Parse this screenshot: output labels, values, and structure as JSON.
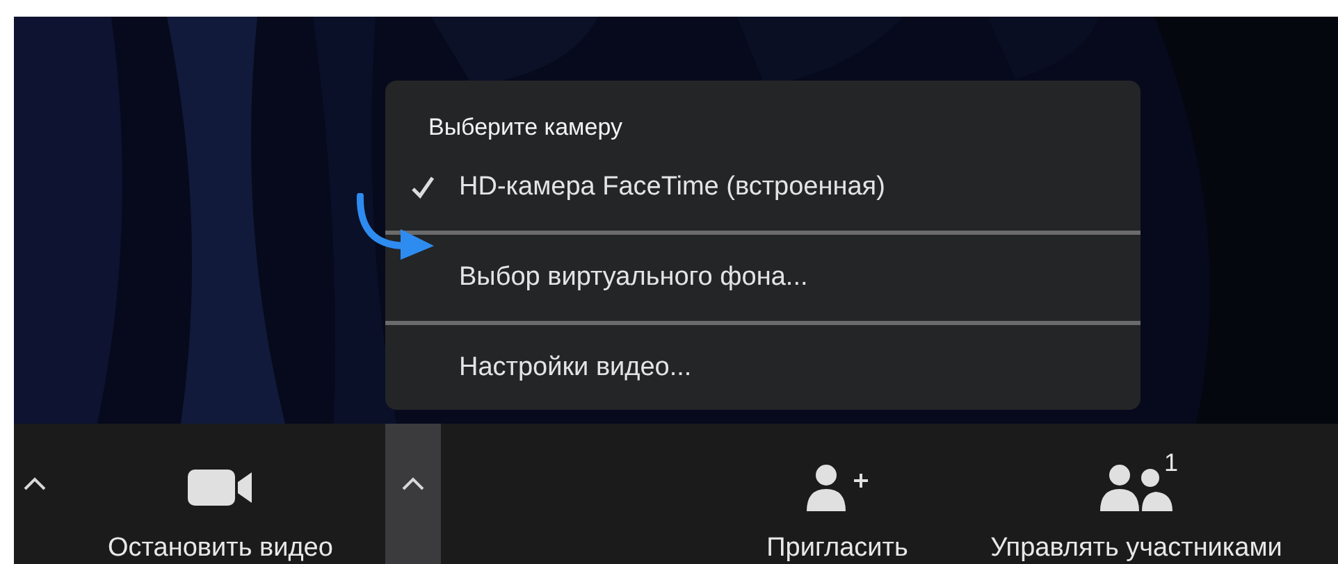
{
  "camera_menu": {
    "heading": "Выберите камеру",
    "items": [
      {
        "label": "HD-камера FaceTime (встроенная)",
        "checked": true,
        "pointed": false
      },
      {
        "label": "Выбор виртуального фона...",
        "checked": false,
        "pointed": true
      },
      {
        "label": "Настройки видео...",
        "checked": false,
        "pointed": false
      }
    ]
  },
  "toolbar": {
    "items": [
      {
        "kind": "caret",
        "selected": false
      },
      {
        "kind": "video",
        "label": "Остановить видео"
      },
      {
        "kind": "caret",
        "selected": true
      },
      {
        "kind": "invite",
        "label": "Пригласить"
      },
      {
        "kind": "participants",
        "label": "Управлять участниками",
        "count": "1"
      }
    ]
  }
}
